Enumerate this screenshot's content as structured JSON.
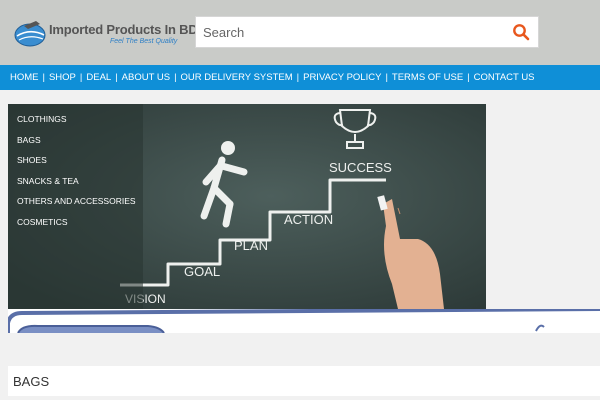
{
  "header": {
    "logo_title": "Imported Products In BD",
    "logo_tagline": "Feel The Best Quality",
    "search_placeholder": "Search",
    "search_icon": "search-icon",
    "accent_color": "#e8571d"
  },
  "nav": {
    "items": [
      {
        "label": "HOME"
      },
      {
        "label": "SHOP"
      },
      {
        "label": "DEAL"
      },
      {
        "label": "ABOUT US"
      },
      {
        "label": "OUR DELIVERY SYSTEM"
      },
      {
        "label": "PRIVACY POLICY"
      },
      {
        "label": "TERMS OF USE"
      },
      {
        "label": "CONTACT US"
      }
    ],
    "color": "#0f8fd7"
  },
  "categories": [
    {
      "label": "CLOTHINGS"
    },
    {
      "label": "BAGS"
    },
    {
      "label": "SHOES"
    },
    {
      "label": "SNACKS & TEA"
    },
    {
      "label": "OTHERS AND ACCESSORIES"
    },
    {
      "label": "COSMETICS"
    }
  ],
  "hero": {
    "steps": [
      "VISION",
      "GOAL",
      "PLAN",
      "ACTION",
      "SUCCESS"
    ]
  },
  "section": {
    "title": "BAGS"
  }
}
